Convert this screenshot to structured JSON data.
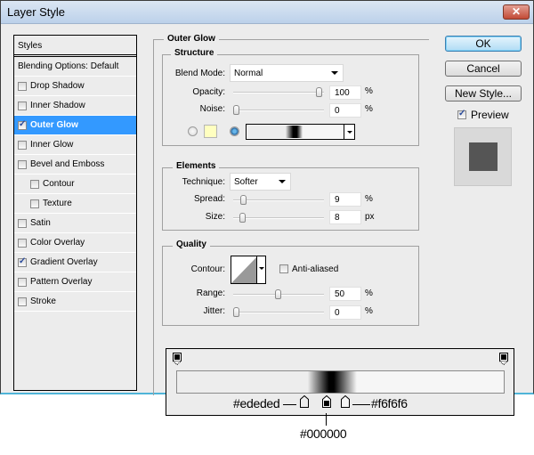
{
  "window": {
    "title": "Layer Style",
    "close_label": "x"
  },
  "styles_panel": {
    "header": "Styles",
    "blending": "Blending Options: Default",
    "items": [
      {
        "label": "Drop Shadow",
        "checked": false,
        "indent": false,
        "selected": false
      },
      {
        "label": "Inner Shadow",
        "checked": false,
        "indent": false,
        "selected": false
      },
      {
        "label": "Outer Glow",
        "checked": true,
        "indent": false,
        "selected": true
      },
      {
        "label": "Inner Glow",
        "checked": false,
        "indent": false,
        "selected": false
      },
      {
        "label": "Bevel and Emboss",
        "checked": false,
        "indent": false,
        "selected": false
      },
      {
        "label": "Contour",
        "checked": false,
        "indent": true,
        "selected": false
      },
      {
        "label": "Texture",
        "checked": false,
        "indent": true,
        "selected": false
      },
      {
        "label": "Satin",
        "checked": false,
        "indent": false,
        "selected": false
      },
      {
        "label": "Color Overlay",
        "checked": false,
        "indent": false,
        "selected": false
      },
      {
        "label": "Gradient Overlay",
        "checked": true,
        "indent": false,
        "selected": false
      },
      {
        "label": "Pattern Overlay",
        "checked": false,
        "indent": false,
        "selected": false
      },
      {
        "label": "Stroke",
        "checked": false,
        "indent": false,
        "selected": false
      }
    ]
  },
  "outer_glow": {
    "title": "Outer Glow",
    "structure": {
      "title": "Structure",
      "blend_mode_label": "Blend Mode:",
      "blend_mode_value": "Normal",
      "opacity_label": "Opacity:",
      "opacity_value": "100",
      "opacity_unit": "%",
      "opacity_fraction": 1.0,
      "noise_label": "Noise:",
      "noise_value": "0",
      "noise_unit": "%",
      "noise_fraction": 0.0,
      "color_swatch": "#ffffc0",
      "color_mode": "gradient"
    },
    "elements": {
      "title": "Elements",
      "technique_label": "Technique:",
      "technique_value": "Softer",
      "spread_label": "Spread:",
      "spread_value": "9",
      "spread_unit": "%",
      "spread_fraction": 0.09,
      "size_label": "Size:",
      "size_value": "8",
      "size_unit": "px",
      "size_fraction": 0.08
    },
    "quality": {
      "title": "Quality",
      "contour_label": "Contour:",
      "anti_aliased_label": "Anti-aliased",
      "anti_aliased": false,
      "range_label": "Range:",
      "range_value": "50",
      "range_unit": "%",
      "range_fraction": 0.5,
      "jitter_label": "Jitter:",
      "jitter_value": "0",
      "jitter_unit": "%",
      "jitter_fraction": 0.0
    }
  },
  "buttons": {
    "ok": "OK",
    "cancel": "Cancel",
    "new_style": "New Style...",
    "preview_label": "Preview",
    "preview_checked": true
  },
  "gradient_callout": {
    "stops": [
      {
        "color": "#ededed",
        "label": "#ededed"
      },
      {
        "color": "#000000",
        "label": "#000000"
      },
      {
        "color": "#f6f6f6",
        "label": "#f6f6f6"
      }
    ]
  }
}
